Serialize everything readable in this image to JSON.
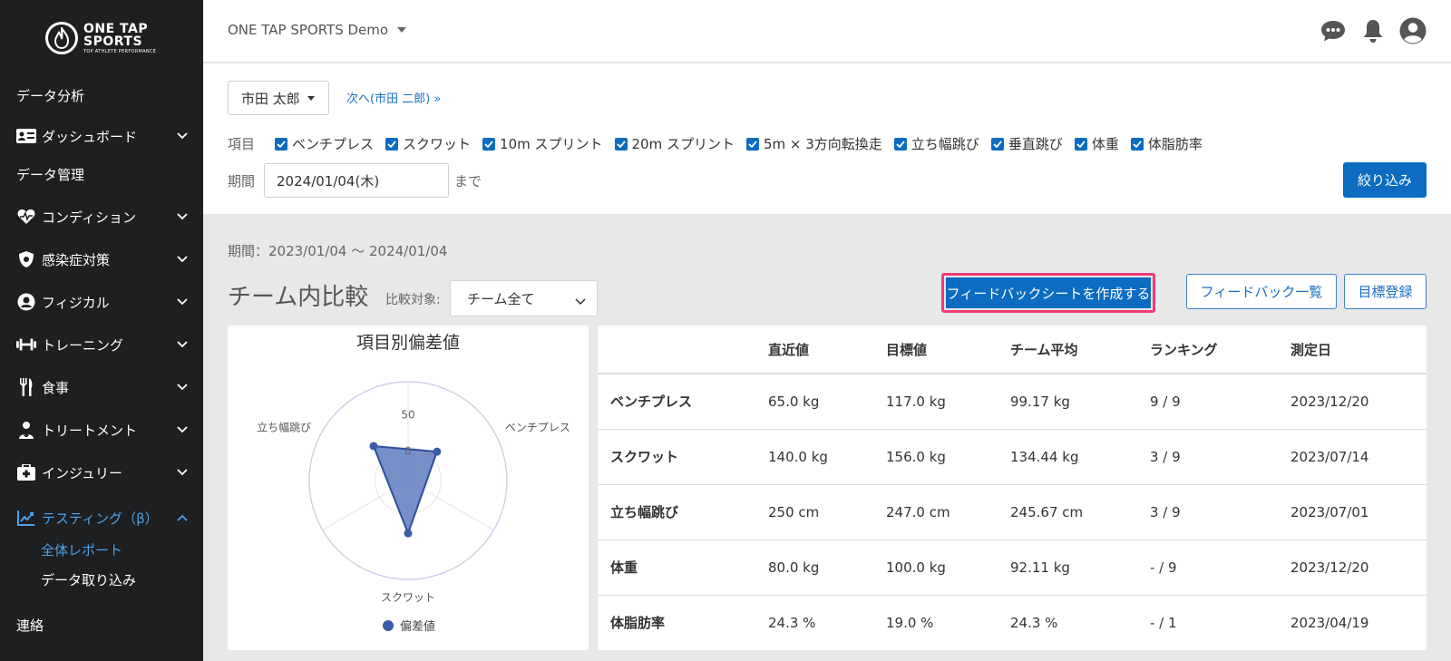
{
  "logo": {
    "line1": "ONE TAP",
    "line2": "SPORTS",
    "tagline": "TOP ATHLETE PERFORMANCE"
  },
  "sidebar": {
    "section_analysis": "データ分析",
    "dashboard": "ダッシュボード",
    "section_data_mgmt": "データ管理",
    "condition": "コンディション",
    "infection": "感染症対策",
    "physical": "フィジカル",
    "training": "トレーニング",
    "meal": "食事",
    "treatment": "トリートメント",
    "injury": "インジュリー",
    "testing": "テスティング（β）",
    "sub_report": "全体レポート",
    "sub_import": "データ取り込み",
    "section_contact": "連絡"
  },
  "header": {
    "team": "ONE TAP SPORTS Demo"
  },
  "filter": {
    "person": "市田 太郎",
    "next_link": "次へ(市田 二郎) »",
    "items_label": "項目",
    "items": [
      "ベンチプレス",
      "スクワット",
      "10m スプリント",
      "20m スプリント",
      "5m × 3方向転換走",
      "立ち幅跳び",
      "垂直跳び",
      "体重",
      "体脂肪率"
    ],
    "period_label": "期間",
    "date_value": "2024/01/04(木)",
    "period_suffix": "まで",
    "filter_button": "絞り込み"
  },
  "content": {
    "period_text": "期間：2023/01/04 〜 2024/01/04",
    "title": "チーム内比較",
    "compare_label": "比較対象:",
    "compare_value": "チーム全て",
    "btn_feedback": "フィードバックシートを作成する",
    "btn_feedback_list": "フィードバック一覧",
    "btn_goal": "目標登録"
  },
  "chart_data": {
    "type": "radar",
    "title": "項目別偏差値",
    "axes": [
      "ベンチプレス",
      "スクワット",
      "立ち幅跳び"
    ],
    "series": [
      {
        "name": "偏差値",
        "values": [
          12,
          30,
          24
        ]
      }
    ],
    "tick_labels": [
      "50",
      "0"
    ],
    "rlim": [
      -50,
      100
    ],
    "legend": "bottom",
    "color": "#4a6bb5"
  },
  "table": {
    "headers": [
      "",
      "直近値",
      "目標値",
      "チーム平均",
      "ランキング",
      "測定日"
    ],
    "rows": [
      [
        "ベンチプレス",
        "65.0 kg",
        "117.0 kg",
        "99.17 kg",
        "9 / 9",
        "2023/12/20"
      ],
      [
        "スクワット",
        "140.0 kg",
        "156.0 kg",
        "134.44 kg",
        "3 / 9",
        "2023/07/14"
      ],
      [
        "立ち幅跳び",
        "250 cm",
        "247.0 cm",
        "245.67 cm",
        "3 / 9",
        "2023/07/01"
      ],
      [
        "体重",
        "80.0 kg",
        "100.0 kg",
        "92.11 kg",
        "- / 9",
        "2023/12/20"
      ],
      [
        "体脂肪率",
        "24.3 %",
        "19.0 %",
        "24.3 %",
        "- / 1",
        "2023/04/19"
      ]
    ]
  },
  "colors": {
    "sidebar_bg": "#1e1f21",
    "accent": "#0b6cc1",
    "active": "#4aa3ea",
    "highlight": "#ef3c78"
  }
}
